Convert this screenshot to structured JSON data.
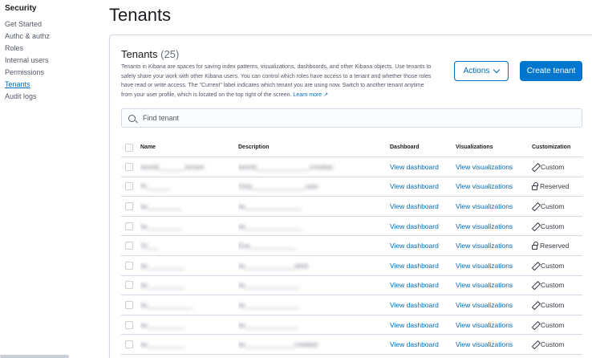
{
  "sidebar": {
    "title": "Security",
    "items": [
      {
        "label": "Get Started",
        "active": false
      },
      {
        "label": "Authc & authz",
        "active": false
      },
      {
        "label": "Roles",
        "active": false
      },
      {
        "label": "Internal users",
        "active": false
      },
      {
        "label": "Permissions",
        "active": false
      },
      {
        "label": "Tenants",
        "active": true
      },
      {
        "label": "Audit logs",
        "active": false
      }
    ]
  },
  "page": {
    "title": "Tenants"
  },
  "panel": {
    "title": "Tenants",
    "count": "(25)",
    "description": "Tenants in Kibana are spaces for saving index patterns, visualizations, dashboards, and other Kibana objects. Use tenants to safely share your work with other Kibana users. You can control which roles have access to a tenant and whether those roles have read or write access. The \"Current\" label indicates which tenant you are using now. Switch to another tenant anytime from your user profile, which is located on the top right of the screen.",
    "learn_more": "Learn more",
    "actions_label": "Actions",
    "create_label": "Create tenant",
    "search_placeholder": "Find tenant"
  },
  "table": {
    "headers": {
      "name": "Name",
      "description": "Description",
      "dashboard": "Dashboard",
      "visualizations": "Visualizations",
      "customization": "Customization"
    },
    "rows": [
      {
        "name": "tworld_______tenant",
        "description": "tworld______________created.",
        "dashboard": "View dashboard",
        "visualizations": "View visualizations",
        "customization": "Custom",
        "custom_icon": "pencil-icon"
      },
      {
        "name": "Pr______",
        "description": "Only______________user",
        "dashboard": "View dashboard",
        "visualizations": "View visualizations",
        "customization": "Reserved",
        "custom_icon": "lock-icon"
      },
      {
        "name": "tw_________",
        "description": "tw_______________",
        "dashboard": "View dashboard",
        "visualizations": "View visualizations",
        "customization": "Custom",
        "custom_icon": "pencil-icon"
      },
      {
        "name": "tw_________",
        "description": "tw_______________",
        "dashboard": "View dashboard",
        "visualizations": "View visualizations",
        "customization": "Custom",
        "custom_icon": "pencil-icon"
      },
      {
        "name": "Gl___",
        "description": "Eve____________",
        "dashboard": "View dashboard",
        "visualizations": "View visualizations",
        "customization": "Reserved",
        "custom_icon": "lock-icon"
      },
      {
        "name": "tw__________",
        "description": "tw_____________ated.",
        "dashboard": "View dashboard",
        "visualizations": "View visualizations",
        "customization": "Custom",
        "custom_icon": "pencil-icon"
      },
      {
        "name": "tw__________",
        "description": "tw______________.",
        "dashboard": "View dashboard",
        "visualizations": "View visualizations",
        "customization": "Custom",
        "custom_icon": "pencil-icon"
      },
      {
        "name": "tw____________",
        "description": "tw______________.",
        "dashboard": "View dashboard",
        "visualizations": "View visualizations",
        "customization": "Custom",
        "custom_icon": "pencil-icon"
      },
      {
        "name": "tw__________",
        "description": "tw______________",
        "dashboard": "View dashboard",
        "visualizations": "View visualizations",
        "customization": "Custom",
        "custom_icon": "pencil-icon"
      },
      {
        "name": "tw__________",
        "description": "tw_____________created.",
        "dashboard": "View dashboard",
        "visualizations": "View visualizations",
        "customization": "Custom",
        "custom_icon": "pencil-icon"
      }
    ]
  }
}
